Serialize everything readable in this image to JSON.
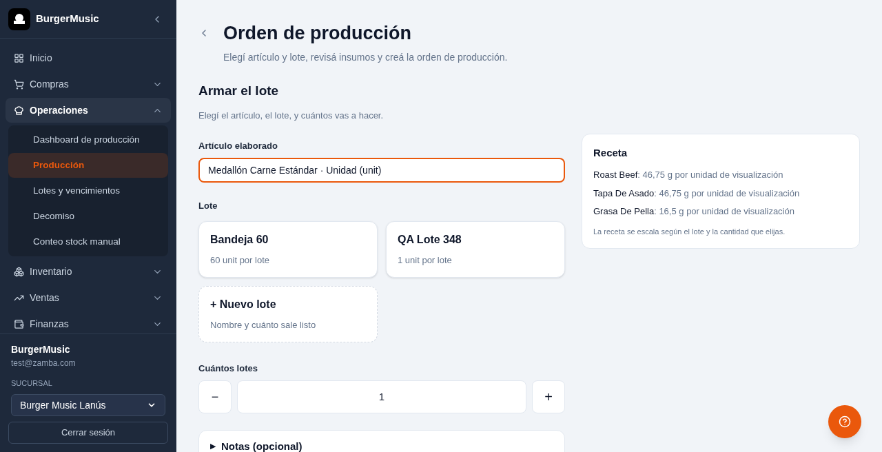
{
  "sidebar": {
    "brand": "BurgerMusic",
    "nav": [
      {
        "label": "Inicio",
        "expanded": false,
        "has_children": false
      },
      {
        "label": "Compras",
        "expanded": false,
        "has_children": true
      },
      {
        "label": "Operaciones",
        "expanded": true,
        "has_children": true,
        "children": [
          {
            "label": "Dashboard de producción",
            "selected": false
          },
          {
            "label": "Producción",
            "selected": true
          },
          {
            "label": "Lotes y vencimientos",
            "selected": false
          },
          {
            "label": "Decomiso",
            "selected": false
          },
          {
            "label": "Conteo stock manual",
            "selected": false
          }
        ]
      },
      {
        "label": "Inventario",
        "expanded": false,
        "has_children": true
      },
      {
        "label": "Ventas",
        "expanded": false,
        "has_children": true
      },
      {
        "label": "Finanzas",
        "expanded": false,
        "has_children": true
      }
    ],
    "user": {
      "name": "BurgerMusic",
      "email": "test@zamba.com"
    },
    "branch_label": "SUCURSAL",
    "branch_value": "Burger Music Lanús",
    "logout": "Cerrar sesión"
  },
  "page": {
    "title": "Orden de producción",
    "subtitle": "Elegí artículo y lote, revisá insumos y creá la orden de producción."
  },
  "section": {
    "title": "Armar el lote",
    "description": "Elegí el artículo, el lote, y cuántos vas a hacer.",
    "article_label": "Artículo elaborado",
    "article_value": "Medallón Carne Estándar · Unidad (unit)",
    "lote_label": "Lote",
    "lotes": [
      {
        "kind": "lote",
        "name": "Bandeja 60",
        "detail": "60 unit por lote"
      },
      {
        "kind": "lote",
        "name": "QA Lote 348",
        "detail": "1 unit por lote"
      },
      {
        "kind": "new",
        "name": "+ Nuevo lote",
        "detail": "Nombre y cuánto sale listo"
      }
    ],
    "qty_label": "Cuántos lotes",
    "qty_minus": "−",
    "qty_value": "1",
    "qty_plus": "+",
    "notes_marker": "▶",
    "notes_label": "Notas (opcional)"
  },
  "recipe": {
    "title": "Receta",
    "items": [
      {
        "name": "Roast Beef",
        "amount": ": 46,75 g por unidad de visualización"
      },
      {
        "name": "Tapa De Asado",
        "amount": ": 46,75 g por unidad de visualización"
      },
      {
        "name": "Grasa De Pella",
        "amount": ": 16,5 g por unidad de visualización"
      }
    ],
    "note": "La receta se escala según el lote y la cantidad que elijas."
  }
}
